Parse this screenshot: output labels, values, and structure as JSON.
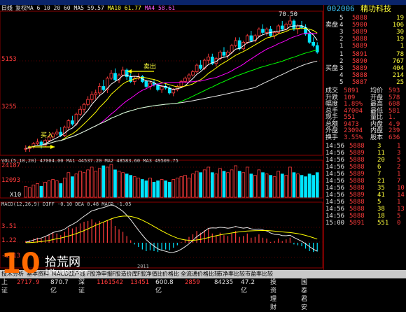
{
  "title_bar": "",
  "stock": {
    "code": "002006",
    "name": "精功科技",
    "period_label": "日线"
  },
  "ma_legend": {
    "ma5_prefix": "MA5",
    "ma5": "59.57",
    "ma10_prefix": "MA10",
    "ma10": "61.77",
    "ma20_prefix": "MA4",
    "ma20": "58.61",
    "lead": "复权MA 6 10 20 60"
  },
  "price_axis": [
    "5153",
    "3255"
  ],
  "price_markers": {
    "high": "70.50"
  },
  "annotations": {
    "buy": "买入",
    "sell": "卖出"
  },
  "vol_legend": "VOL(5,10,20)  47004.00  MA1 44537.20  MA2 48583.60  MA3 49509.75",
  "vol_axis": [
    "24187",
    "12093",
    "X10"
  ],
  "macd_legend": "MACD(12,26,9)  DIFF -0.10  DEA 0.48  MACD -1.05",
  "macd_axis": [
    "3.51",
    "1.22",
    "-1.13"
  ],
  "year_label": "2011",
  "orderbook": {
    "label_sell": "卖盘",
    "label_buy": "买盘",
    "asks": [
      {
        "level": "5",
        "price": "5888",
        "vol": "19"
      },
      {
        "level": "4",
        "price": "5900",
        "vol": "106"
      },
      {
        "level": "3",
        "price": "5889",
        "vol": "30"
      },
      {
        "level": "2",
        "price": "5888",
        "vol": "19"
      },
      {
        "level": "1",
        "price": "5889",
        "vol": "1"
      }
    ],
    "bids": [
      {
        "level": "1",
        "price": "5891",
        "vol": "78"
      },
      {
        "level": "2",
        "price": "5890",
        "vol": "767"
      },
      {
        "level": "3",
        "price": "5889",
        "vol": "404"
      },
      {
        "level": "4",
        "price": "5888",
        "vol": "214"
      },
      {
        "level": "5",
        "price": "5887",
        "vol": "25"
      }
    ]
  },
  "quote": [
    {
      "k": "成交",
      "v": "5891",
      "k2": "均价",
      "v2": "593"
    },
    {
      "k": "升跌",
      "v": "109",
      "k2": "开盘",
      "v2": "578"
    },
    {
      "k": "幅度",
      "v": "1.89%",
      "k2": "最高",
      "v2": "608"
    },
    {
      "k": "总手",
      "v": "47004",
      "k2": "最低",
      "v2": "581"
    },
    {
      "k": "现手",
      "v": "551",
      "k2": "量比",
      "v2": "1."
    },
    {
      "k": "总额",
      "v": "9473",
      "k2": "内盘",
      "v2": "4.9"
    },
    {
      "k": "外盘",
      "v": "23094",
      "k2": "内盘",
      "v2": "239"
    },
    {
      "k": "换手",
      "v": "3.55%",
      "k2": "股本",
      "v2": "636"
    }
  ],
  "ticks": [
    {
      "t": "14:56",
      "p": "5888",
      "v": "3",
      "n": "1"
    },
    {
      "t": "14:56",
      "p": "5889",
      "v": "11",
      "n": "3"
    },
    {
      "t": "14:56",
      "p": "5888",
      "v": "20",
      "n": "5"
    },
    {
      "t": "14:56",
      "p": "5888",
      "v": "6",
      "n": "2"
    },
    {
      "t": "14:56",
      "p": "5889",
      "v": "7",
      "n": "1"
    },
    {
      "t": "14:56",
      "p": "5888",
      "v": "21",
      "n": "7"
    },
    {
      "t": "14:56",
      "p": "5888",
      "v": "35",
      "n": "10"
    },
    {
      "t": "14:56",
      "p": "5889",
      "v": "41",
      "n": "14"
    },
    {
      "t": "14:56",
      "p": "5888",
      "v": "5",
      "n": "1"
    },
    {
      "t": "14:56",
      "p": "5888",
      "v": "38",
      "n": "13"
    },
    {
      "t": "14:56",
      "p": "5888",
      "v": "18",
      "n": "5"
    },
    {
      "t": "15:00",
      "p": "5891",
      "v": "551",
      "n": "0"
    }
  ],
  "tabs": [
    "技术分析",
    "基本资料",
    "MACD",
    "散户线",
    "F股净申报",
    "F股造价库",
    "F股净值比",
    "价格比",
    "全流通价格比较",
    "市净率比较",
    "市盈率比较"
  ],
  "status": [
    {
      "text": "上证",
      "cls": "wht"
    },
    {
      "text": "2717.9",
      "cls": "red"
    },
    {
      "text": "870.7亿",
      "cls": "wht"
    },
    {
      "text": "深证",
      "cls": "wht"
    },
    {
      "text": "1161542",
      "cls": "red"
    },
    {
      "text": "13451",
      "cls": "red"
    },
    {
      "text": "600.8亿",
      "cls": "wht"
    },
    {
      "text": "2859",
      "cls": "red"
    },
    {
      "text": "84235",
      "cls": "wht"
    },
    {
      "text": "47.2亿",
      "cls": "wht"
    },
    {
      "text": "投资理财",
      "cls": "wht"
    },
    {
      "text": "国泰君安",
      "cls": "wht"
    }
  ],
  "watermark": {
    "num": "10",
    "cn": "拾荒网",
    "url": "10huang.com"
  },
  "colors": {
    "up": "#ff3c3c",
    "down": "#00e5ff",
    "ma5": "#ffffff",
    "ma10": "#ffff00",
    "ma20": "#ff00ff",
    "ma60": "#00ff00",
    "bg": "#000000"
  },
  "chart_data": {
    "type": "candlestick",
    "candles": [
      [
        30,
        31,
        29,
        30
      ],
      [
        30,
        31,
        29,
        30.5
      ],
      [
        30.5,
        32,
        30,
        31.5
      ],
      [
        31.5,
        33,
        31,
        32
      ],
      [
        32,
        32.5,
        30,
        31
      ],
      [
        31,
        33,
        30.5,
        32.5
      ],
      [
        32.5,
        34,
        32,
        33.5
      ],
      [
        33.5,
        35,
        33,
        34.5
      ],
      [
        34.5,
        36,
        34,
        35
      ],
      [
        35,
        36.5,
        33.5,
        34
      ],
      [
        34,
        37,
        33.5,
        36.5
      ],
      [
        36.5,
        39,
        36,
        38.5
      ],
      [
        38.5,
        40,
        37,
        37.5
      ],
      [
        37.5,
        41,
        37,
        40.5
      ],
      [
        40.5,
        43,
        40,
        42
      ],
      [
        42,
        44,
        41,
        43.5
      ],
      [
        43.5,
        46,
        43,
        45
      ],
      [
        45,
        47.5,
        44,
        46.5
      ],
      [
        46.5,
        48,
        45,
        47
      ],
      [
        47,
        50,
        46,
        49
      ],
      [
        49,
        51,
        47.5,
        48
      ],
      [
        48,
        52,
        47,
        51.5
      ],
      [
        51.5,
        54,
        51,
        53
      ],
      [
        53,
        54.5,
        50.5,
        51
      ],
      [
        51,
        53,
        50,
        52.5
      ],
      [
        52.5,
        55,
        52,
        54
      ],
      [
        54,
        54.5,
        51,
        52
      ],
      [
        52,
        53,
        50,
        50.5
      ],
      [
        50.5,
        52,
        49.5,
        51.5
      ],
      [
        51.5,
        53,
        51,
        52
      ],
      [
        52,
        52.5,
        50,
        50.5
      ],
      [
        50.5,
        51,
        48.5,
        49
      ],
      [
        49,
        50.5,
        48,
        50
      ],
      [
        50,
        51,
        49,
        49.5
      ],
      [
        49.5,
        50,
        47.5,
        48
      ],
      [
        48,
        49.5,
        47,
        49
      ],
      [
        49,
        50,
        48,
        48.5
      ],
      [
        48.5,
        49,
        46.5,
        47
      ],
      [
        47,
        48.5,
        46,
        48
      ],
      [
        48,
        49.5,
        47.5,
        49
      ],
      [
        49,
        51,
        48.5,
        50.5
      ],
      [
        50.5,
        52,
        50,
        51.5
      ],
      [
        51.5,
        53,
        50.5,
        52.5
      ],
      [
        52.5,
        54,
        52,
        53.5
      ],
      [
        53.5,
        56,
        53,
        55.5
      ],
      [
        55.5,
        57,
        54,
        54.5
      ],
      [
        54.5,
        57.5,
        54,
        57
      ],
      [
        57,
        59,
        56,
        58
      ],
      [
        58,
        59,
        55.5,
        56
      ],
      [
        56,
        58,
        55,
        57.5
      ],
      [
        57.5,
        60,
        57,
        59.5
      ],
      [
        59.5,
        61,
        58,
        58.5
      ],
      [
        58.5,
        60,
        57.5,
        59.5
      ],
      [
        59.5,
        62,
        59,
        61.5
      ],
      [
        61.5,
        64,
        61,
        63
      ],
      [
        63,
        64,
        60,
        60.5
      ],
      [
        60.5,
        63,
        60,
        62.5
      ],
      [
        62.5,
        65,
        62,
        64.5
      ],
      [
        64.5,
        66,
        62.5,
        63
      ],
      [
        63,
        65,
        62.5,
        64.5
      ],
      [
        64.5,
        67,
        64,
        66.5
      ],
      [
        66.5,
        68,
        65,
        65.5
      ],
      [
        65.5,
        67,
        64.5,
        66.5
      ],
      [
        66.5,
        67.5,
        64,
        64.5
      ],
      [
        64.5,
        66,
        63.5,
        65.5
      ],
      [
        65.5,
        68,
        65,
        67.5
      ],
      [
        67.5,
        69,
        66,
        66.5
      ],
      [
        66.5,
        68.5,
        66,
        68
      ],
      [
        68,
        70.5,
        67.5,
        69
      ],
      [
        69,
        69.5,
        66,
        66.5
      ],
      [
        66.5,
        68,
        65,
        67.5
      ],
      [
        67.5,
        69,
        66.5,
        67
      ],
      [
        67,
        68,
        64.5,
        65
      ],
      [
        65,
        66.5,
        62,
        62.5
      ],
      [
        62.5,
        64,
        61,
        61.5
      ],
      [
        61.5,
        62.5,
        59,
        59.5
      ]
    ],
    "volume": [
      8,
      7,
      9,
      10,
      8,
      11,
      12,
      13,
      12,
      10,
      14,
      18,
      15,
      17,
      19,
      18,
      20,
      22,
      19,
      21,
      23,
      22,
      24,
      20,
      19,
      18,
      17,
      16,
      15,
      14,
      13,
      12,
      14,
      11,
      12,
      13,
      12,
      11,
      13,
      14,
      15,
      16,
      14,
      17,
      19,
      18,
      20,
      22,
      18,
      17,
      21,
      19,
      18,
      20,
      23,
      19,
      18,
      22,
      17,
      16,
      20,
      18,
      17,
      16,
      15,
      19,
      17,
      16,
      22,
      18,
      17,
      16,
      15,
      17,
      16,
      18
    ],
    "macd_hist": [
      0.2,
      0.3,
      0.5,
      0.6,
      0.5,
      0.8,
      1.0,
      1.2,
      1.1,
      0.9,
      1.3,
      1.8,
      1.7,
      1.9,
      2.3,
      2.5,
      2.6,
      2.8,
      2.4,
      2.6,
      2.5,
      2.7,
      2.9,
      2.0,
      1.6,
      1.3,
      0.8,
      0.3,
      -0.2,
      -0.5,
      -0.8,
      -1.0,
      -0.9,
      -1.0,
      -1.1,
      -0.9,
      -0.8,
      -0.9,
      -0.6,
      -0.3,
      0.1,
      0.4,
      0.7,
      1.0,
      1.4,
      1.2,
      1.5,
      1.7,
      1.1,
      0.9,
      1.2,
      0.9,
      0.8,
      1.1,
      1.4,
      0.7,
      0.8,
      1.1,
      0.6,
      0.7,
      1.0,
      0.6,
      0.5,
      0.1,
      0.2,
      0.5,
      0.2,
      0.4,
      0.6,
      -0.2,
      -0.3,
      -0.4,
      -0.7,
      -1.0,
      -1.1,
      -1.05
    ]
  }
}
